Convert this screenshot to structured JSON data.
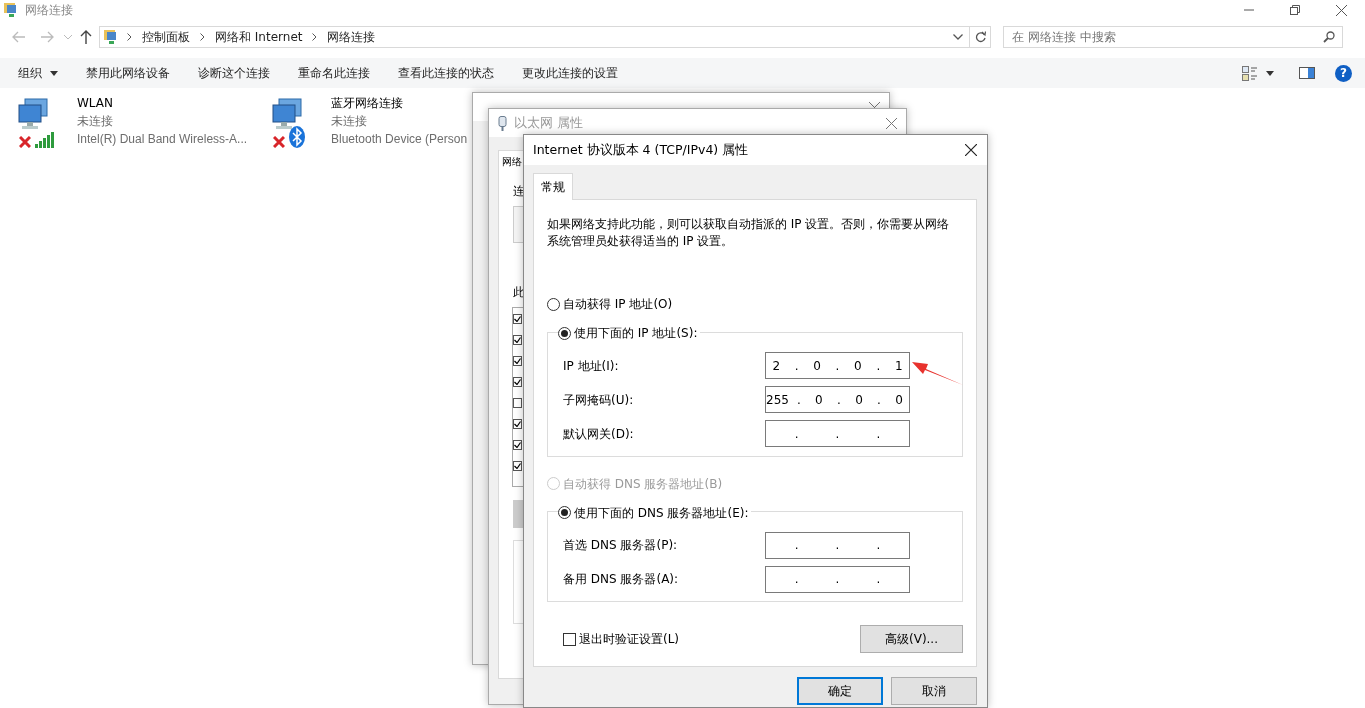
{
  "explorer": {
    "title": "网络连接",
    "breadcrumb": [
      "控制面板",
      "网络和 Internet",
      "网络连接"
    ],
    "search": {
      "placeholder": "在 网络连接 中搜索"
    },
    "commands": [
      {
        "label": "组织",
        "dropdown": true
      },
      {
        "label": "禁用此网络设备",
        "dropdown": false
      },
      {
        "label": "诊断这个连接",
        "dropdown": false
      },
      {
        "label": "重命名此连接",
        "dropdown": false
      },
      {
        "label": "查看此连接的状态",
        "dropdown": false
      },
      {
        "label": "更改此连接的设置",
        "dropdown": false
      }
    ],
    "help": "?"
  },
  "connections": [
    {
      "name": "WLAN",
      "status": "未连接",
      "device": "Intel(R) Dual Band Wireless-A...",
      "kind": "wifi"
    },
    {
      "name": "蓝牙网络连接",
      "status": "未连接",
      "device": "Bluetooth Device (Person",
      "kind": "bluetooth"
    }
  ],
  "back_windows": [
    {
      "kind": "frame"
    },
    {
      "kind": "dialog",
      "title": "以太网 属性",
      "tab": "网络",
      "labels": [
        "连",
        "此"
      ],
      "components": [
        {
          "checked": true
        },
        {
          "checked": true
        },
        {
          "checked": true
        },
        {
          "checked": true
        },
        {
          "checked": false
        },
        {
          "checked": true
        },
        {
          "checked": true
        },
        {
          "checked": true
        }
      ]
    }
  ],
  "dialog": {
    "title": "Internet 协议版本 4 (TCP/IPv4) 属性",
    "tabs": [
      {
        "label": "常规",
        "selected": true
      }
    ],
    "intro": "如果网络支持此功能，则可以获取自动指派的 IP 设置。否则，你需要从网络系统管理员处获得适当的 IP 设置。",
    "ip_mode": [
      {
        "label": "自动获得 IP 地址(O)",
        "selected": false,
        "disabled": false
      },
      {
        "label": "使用下面的 IP 地址(S):",
        "selected": true,
        "disabled": false
      }
    ],
    "ip_fields": [
      {
        "label": "IP 地址(I):",
        "parts": [
          "2",
          ".",
          "0",
          ".",
          "0",
          ".",
          "1"
        ]
      },
      {
        "label": "子网掩码(U):",
        "parts": [
          "255",
          ".",
          "0",
          ".",
          "0",
          ".",
          "0"
        ]
      },
      {
        "label": "默认网关(D):",
        "parts": [
          ".",
          ".",
          "."
        ]
      }
    ],
    "dns_mode": [
      {
        "label": "自动获得 DNS 服务器地址(B)",
        "selected": false,
        "disabled": true
      },
      {
        "label": "使用下面的 DNS 服务器地址(E):",
        "selected": true,
        "disabled": false
      }
    ],
    "dns_fields": [
      {
        "label": "首选 DNS 服务器(P):",
        "parts": [
          ".",
          ".",
          "."
        ]
      },
      {
        "label": "备用 DNS 服务器(A):",
        "parts": [
          ".",
          ".",
          "."
        ]
      }
    ],
    "validate": {
      "label": "退出时验证设置(L)",
      "checked": false
    },
    "advanced": "高级(V)...",
    "buttons": [
      {
        "label": "确定",
        "default": true
      },
      {
        "label": "取消",
        "default": false
      }
    ]
  }
}
